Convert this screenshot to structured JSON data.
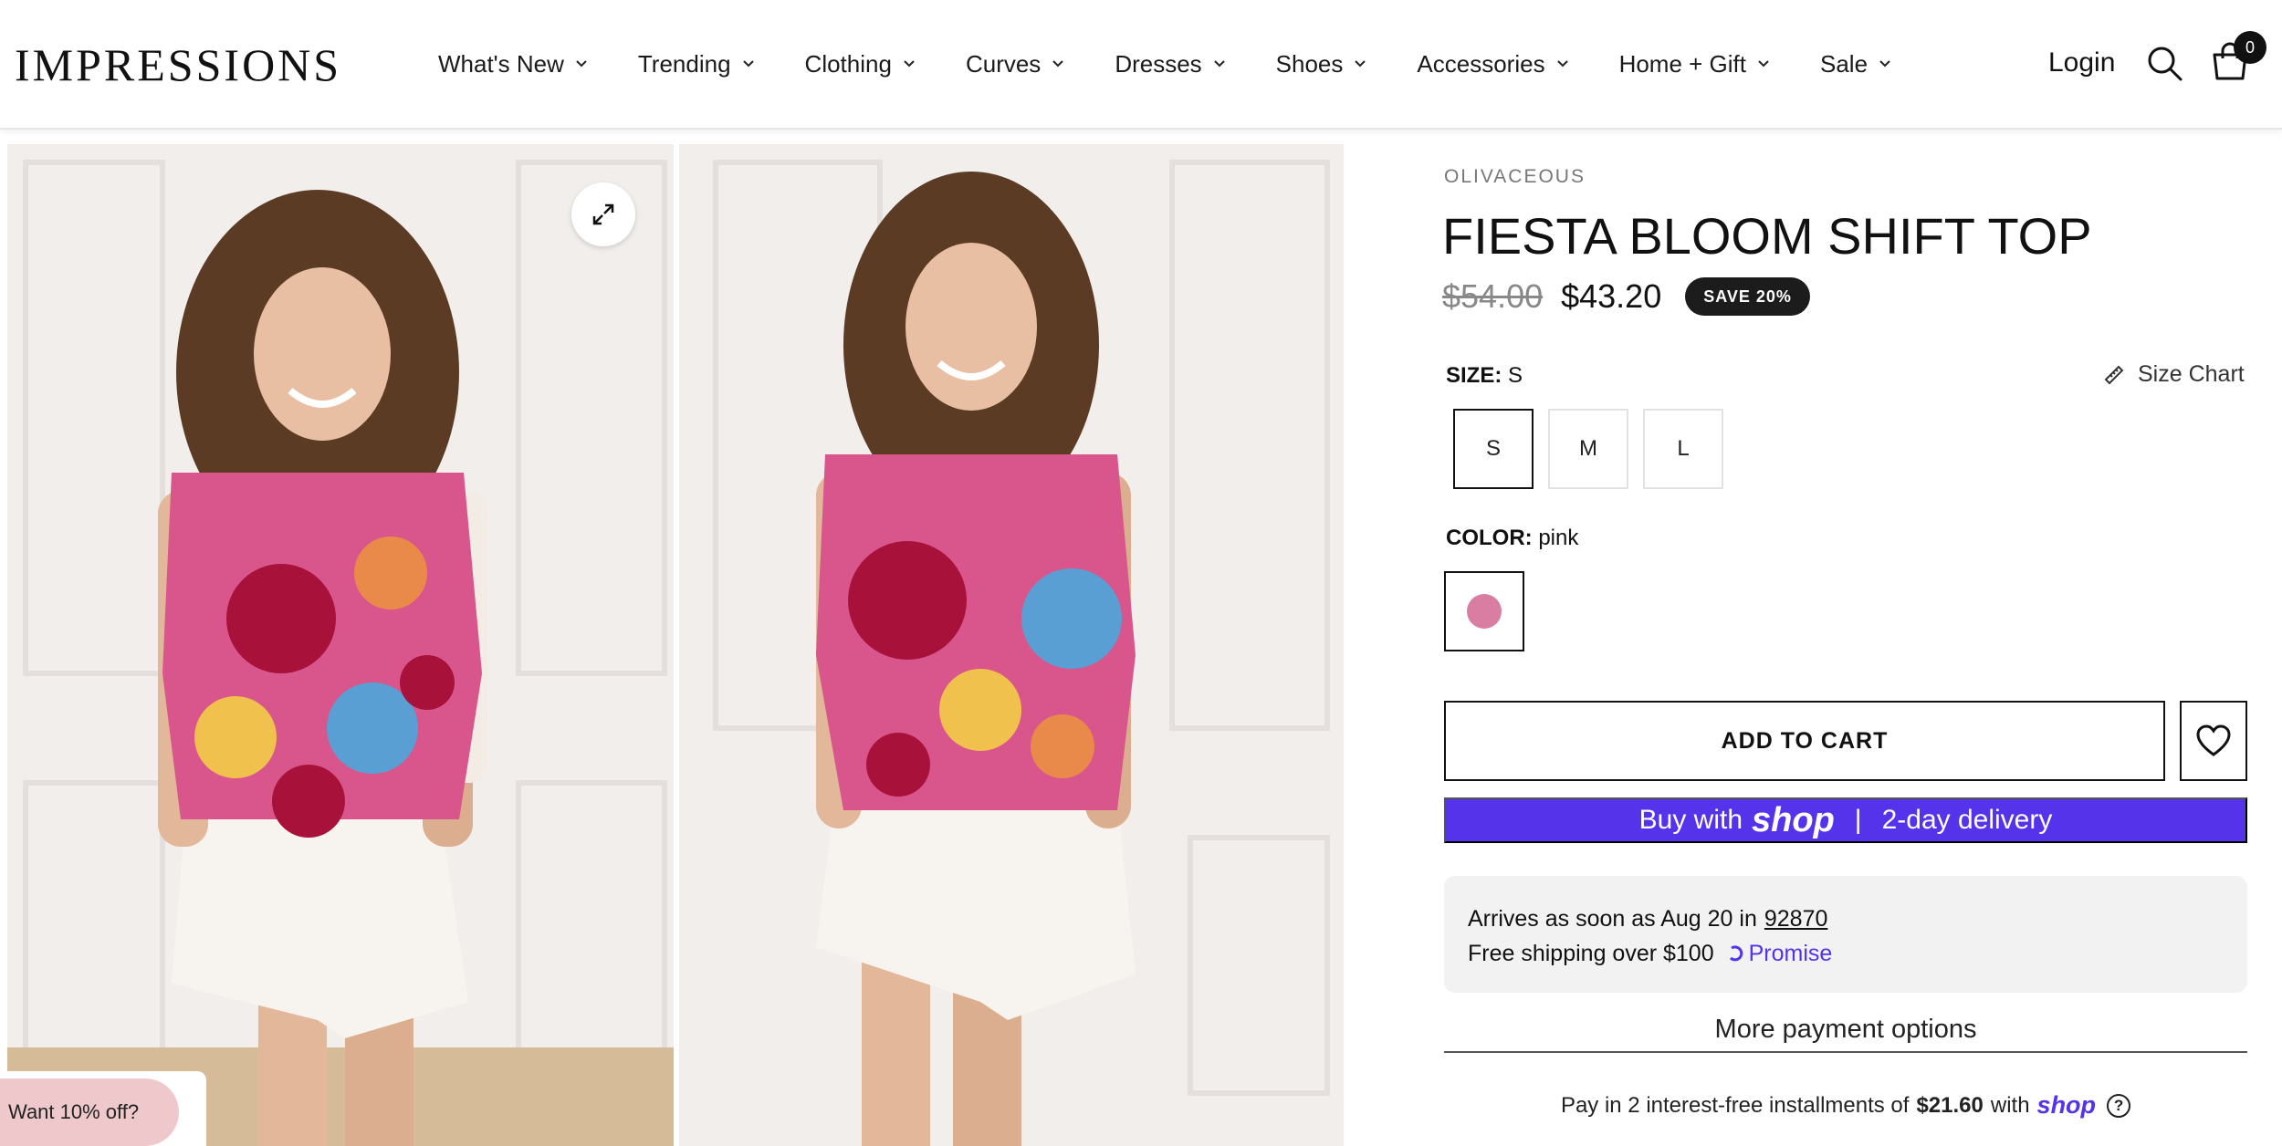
{
  "header": {
    "logo": "IMPRESSIONS",
    "nav": [
      "What's New",
      "Trending",
      "Clothing",
      "Curves",
      "Dresses",
      "Shoes",
      "Accessories",
      "Home + Gift",
      "Sale"
    ],
    "login": "Login",
    "cart_count": "0"
  },
  "gallery": {
    "promo": "Want 10% off?"
  },
  "product": {
    "vendor": "OLIVACEOUS",
    "title": "FIESTA BLOOM SHIFT TOP",
    "compare_price": "$54.00",
    "price": "$43.20",
    "save_badge": "SAVE 20%",
    "size_label": "SIZE:",
    "size_value": "S",
    "size_chart": "Size Chart",
    "sizes": [
      "S",
      "M",
      "L"
    ],
    "color_label": "COLOR:",
    "color_value": "pink",
    "swatch_color": "#d97da3",
    "add_to_cart": "ADD TO CART",
    "buy_with": "Buy with",
    "shop_word": "shop",
    "divider": "|",
    "delivery_note": "2-day delivery",
    "arrives": "Arrives as soon as Aug 20 in",
    "zip": "92870",
    "free_shipping": "Free shipping over $100",
    "promise": "Promise",
    "more_payment": "More payment options",
    "installments_pre": "Pay in 2 interest-free installments of",
    "installments_amount": "$21.60",
    "installments_with": "with",
    "installments_shop": "shop",
    "help_glyph": "?"
  },
  "colors": {
    "shop_purple": "#5433eb",
    "accent_dark": "#1c1c1c",
    "promo_pink": "#efc8cc"
  }
}
